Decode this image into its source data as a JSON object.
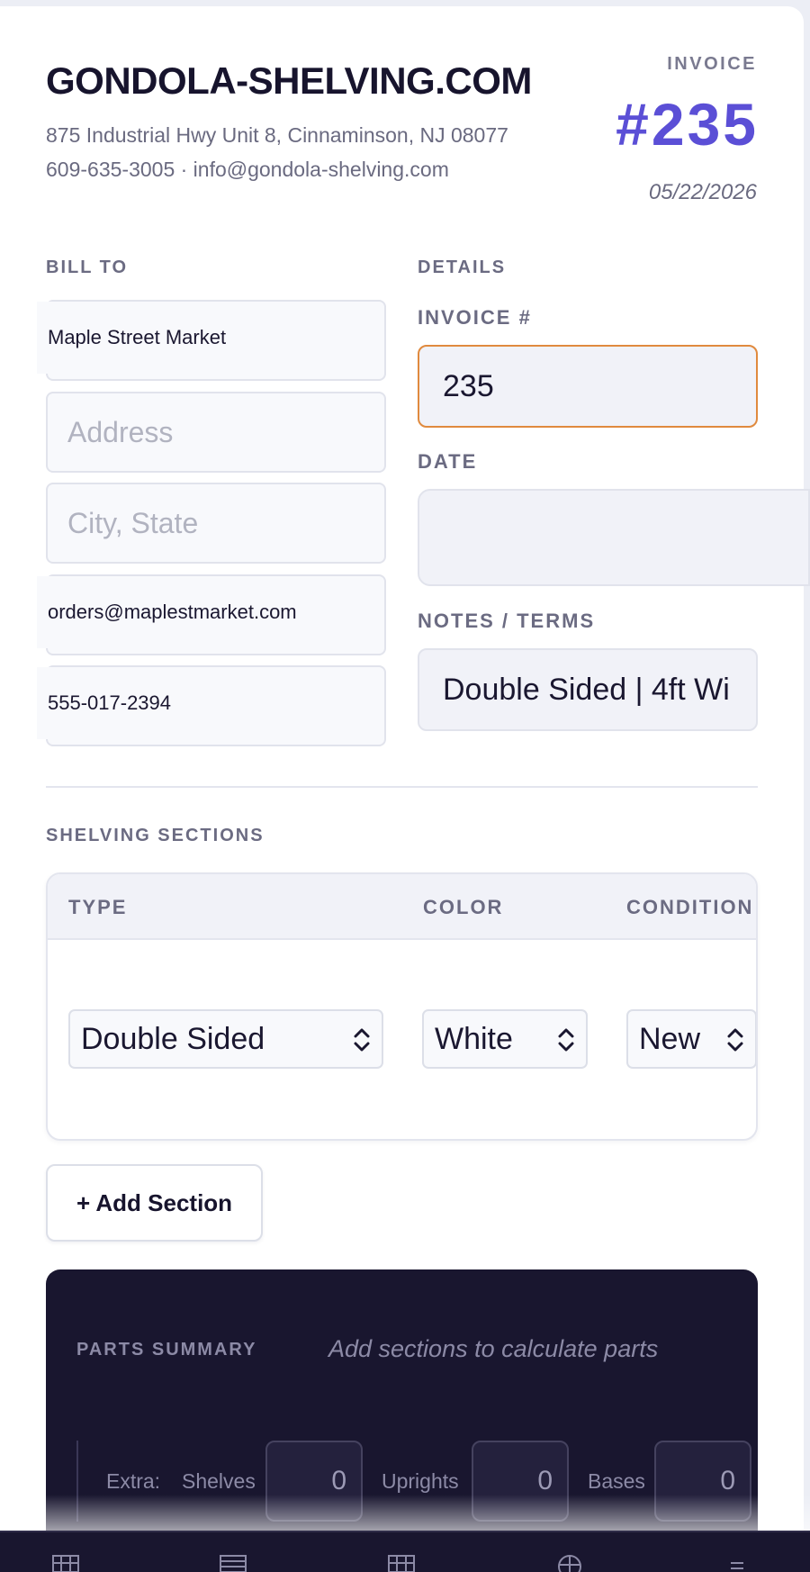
{
  "company": {
    "name": "GONDOLA-SHELVING.COM",
    "address": "875 Industrial Hwy Unit 8, Cinnaminson, NJ 08077",
    "contact": "609-635-3005 · info@gondola-shelving.com"
  },
  "invoice": {
    "label": "INVOICE",
    "number_display": "#235",
    "date_display": "05/22/2026"
  },
  "bill_to": {
    "label": "BILL TO",
    "name_value": "Maple Street Market",
    "address_placeholder": "Address",
    "city_placeholder": "City, State",
    "email_value": "orders@maplestmarket.com",
    "phone_value": "555-017-2394"
  },
  "details": {
    "label": "DETAILS",
    "invoice_no_label": "INVOICE #",
    "invoice_no_value": "235",
    "date_label": "DATE",
    "date_value": "",
    "notes_label": "NOTES / TERMS",
    "notes_value": "Double Sided | 4ft Wi"
  },
  "sections": {
    "label": "SHELVING SECTIONS",
    "columns": [
      "TYPE",
      "COLOR",
      "CONDITION"
    ],
    "row": {
      "type": "Double Sided",
      "color": "White",
      "condition": "New"
    },
    "add_button": "+ Add Section"
  },
  "summary": {
    "label": "PARTS SUMMARY",
    "hint": "Add sections to calculate parts",
    "extra_label": "Extra:",
    "shelves_label": "Shelves",
    "shelves_value": "0",
    "uprights_label": "Uprights",
    "uprights_value": "0",
    "bases_label": "Bases",
    "bases_value": "0"
  },
  "nav": {
    "icons": [
      "grid-icon",
      "list-icon",
      "grid-icon",
      "globe-icon",
      "menu-icon"
    ]
  },
  "colors": {
    "accent": "#5b4fd6",
    "dark": "#19162f",
    "focus": "#e08a3e"
  }
}
